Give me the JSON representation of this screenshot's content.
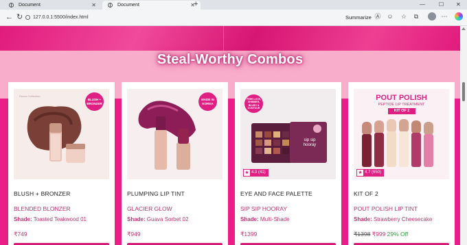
{
  "browser": {
    "tabs": [
      {
        "label": "Document"
      },
      {
        "label": "Document"
      }
    ],
    "url": "127.0.0.1:5500/index.html",
    "summarize_label": "Summarize"
  },
  "section": {
    "title": "Steal-Worthy Combos"
  },
  "products": [
    {
      "name": "BLUSH + BRONZER",
      "subtitle": "BLENDED BLONZER",
      "shade_label": "Shade:",
      "shade": "Toasted Teakwood 01",
      "price": "₹749",
      "badge": "BLUSH + BRONZER",
      "image_tag": "Renee Collection"
    },
    {
      "name": "PLUMPING LIP TINT",
      "subtitle": "GLACIER GLOW",
      "shade_label": "Shade:",
      "shade": "Guava Sorbet 02",
      "price": "₹949",
      "badge": "MADE IN KOREA"
    },
    {
      "name": "EYE AND FACE PALETTE",
      "subtitle": "SIP SIP HOORAY",
      "shade_label": "Shade:",
      "shade": "Multi-Shade",
      "price": "₹1399",
      "badge": "FREE LOVE, SHIMMER, BLUSH & CONTOUR",
      "rating": "4.9 (41)",
      "palette_text": "sip sip hooray"
    },
    {
      "name": "KIT OF 2",
      "subtitle": "POUT POLISH LIP TINT",
      "shade_label": "Shade:",
      "shade": "Strawberry Cheesecake",
      "old_price": "₹1398",
      "price": "₹999",
      "discount": "29% Off",
      "rating": "4.7 (650)",
      "image_heading": "POUT POLISH",
      "image_subheading": "PEPTIDE LIP TREATMENT",
      "image_kit": "KIT OF 2"
    }
  ],
  "colors": {
    "brand_pink": "#e91e86",
    "accent_text": "#c0306f",
    "discount_green": "#2a9a3a"
  }
}
